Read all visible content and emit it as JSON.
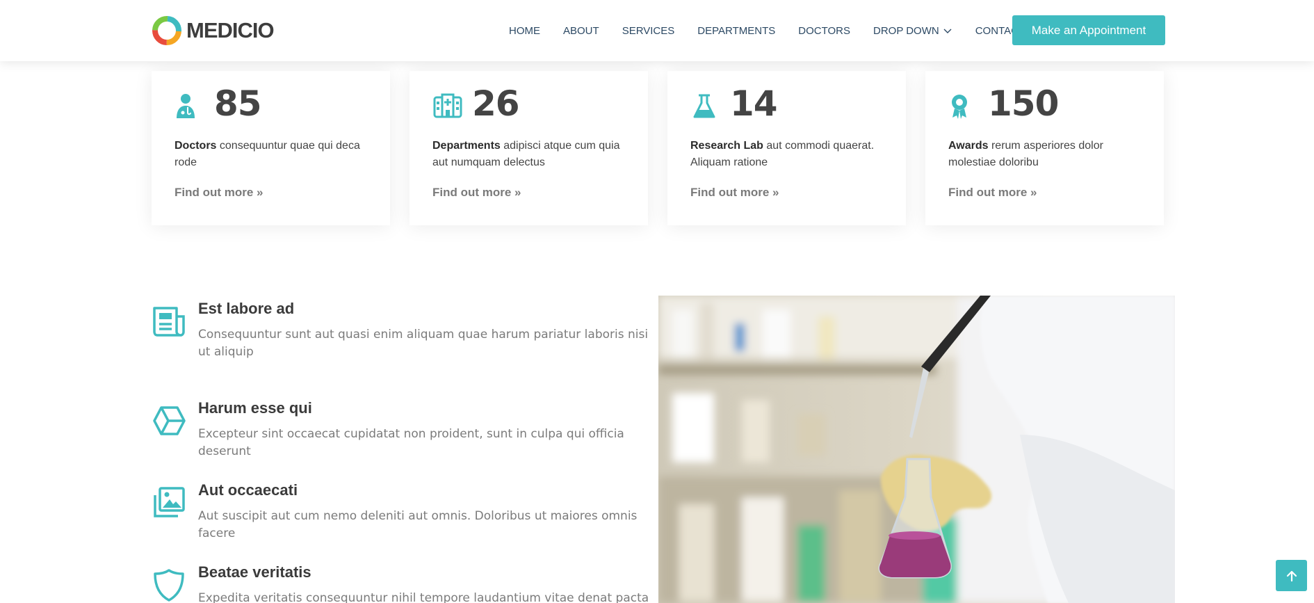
{
  "brand": {
    "name": "MEDICIO",
    "accent": "#3fbbc0"
  },
  "nav": {
    "items": [
      {
        "label": "HOME"
      },
      {
        "label": "ABOUT"
      },
      {
        "label": "SERVICES"
      },
      {
        "label": "DEPARTMENTS"
      },
      {
        "label": "DOCTORS"
      },
      {
        "label": "DROP DOWN"
      },
      {
        "label": "CONTACT"
      }
    ],
    "cta": "Make an Appointment"
  },
  "stats": [
    {
      "icon": "doctor-icon",
      "count": "85",
      "title": "Doctors",
      "text": " consequuntur quae qui deca rode",
      "link": "Find out more »"
    },
    {
      "icon": "hospital-icon",
      "count": "26",
      "title": "Departments",
      "text": " adipisci atque cum quia aut numquam delectus",
      "link": "Find out more »"
    },
    {
      "icon": "flask-icon",
      "count": "14",
      "title": "Research Lab",
      "text": " aut commodi quaerat. Aliquam ratione",
      "link": "Find out more »"
    },
    {
      "icon": "award-icon",
      "count": "150",
      "title": "Awards",
      "text": " rerum asperiores dolor molestiae doloribu",
      "link": "Find out more »"
    }
  ],
  "features": [
    {
      "icon": "newspaper-icon",
      "title": "Est labore ad",
      "desc": "Consequuntur sunt aut quasi enim aliquam quae harum pariatur laboris nisi ut aliquip"
    },
    {
      "icon": "box-icon",
      "title": "Harum esse qui",
      "desc": "Excepteur sint occaecat cupidatat non proident, sunt in culpa qui officia deserunt"
    },
    {
      "icon": "images-icon",
      "title": "Aut occaecati",
      "desc": "Aut suscipit aut cum nemo deleniti aut omnis. Doloribus ut maiores omnis facere"
    },
    {
      "icon": "shield-icon",
      "title": "Beatae veritatis",
      "desc": "Expedita veritatis consequuntur nihil tempore laudantium vitae denat pacta"
    }
  ]
}
